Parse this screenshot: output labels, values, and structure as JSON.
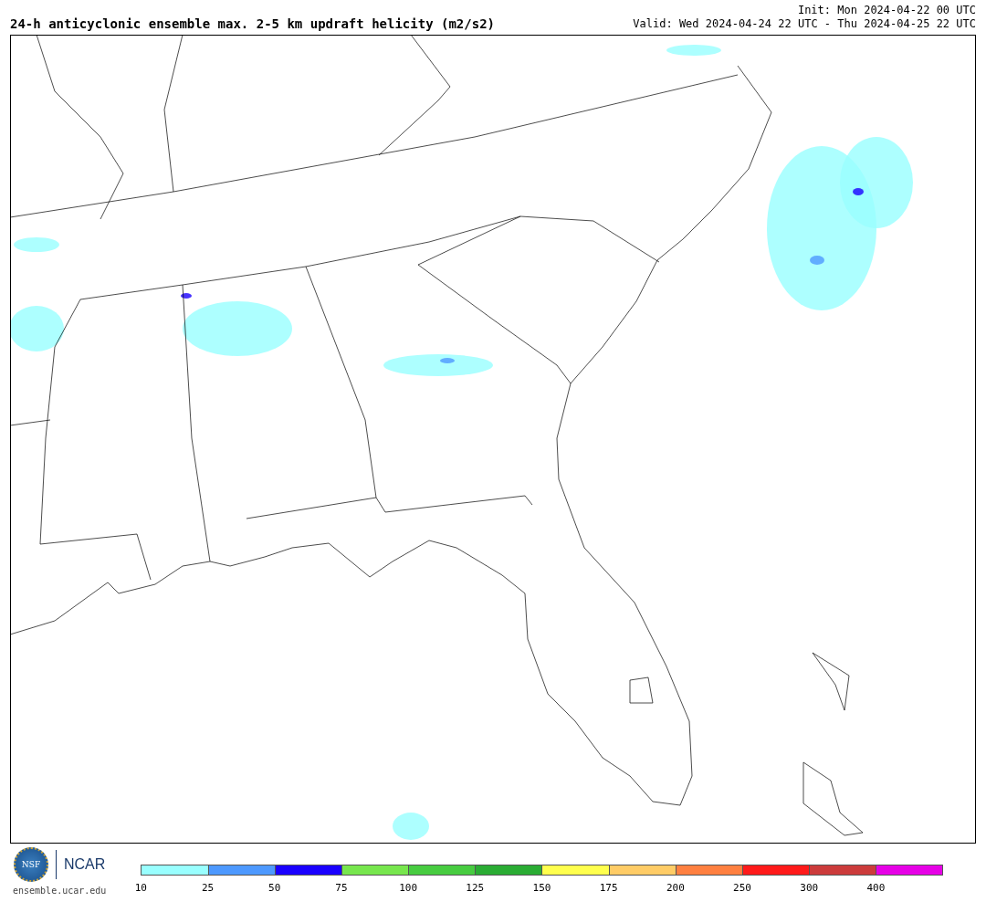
{
  "header": {
    "title": "24-h anticyclonic ensemble max. 2-5 km updraft helicity (m2/s2)",
    "init": "Init: Mon 2024-04-22 00 UTC",
    "valid": "Valid: Wed 2024-04-24 22 UTC - Thu 2024-04-25 22 UTC"
  },
  "footer": {
    "logos": [
      "NSF",
      "NCAR"
    ],
    "site": "ensemble.ucar.edu"
  },
  "colorbar": [
    {
      "label": "10",
      "color": "#99ffff"
    },
    {
      "label": "25",
      "color": "#4d99ff"
    },
    {
      "label": "50",
      "color": "#1a00ff"
    },
    {
      "label": "75",
      "color": "#77e64d"
    },
    {
      "label": "100",
      "color": "#47cc40"
    },
    {
      "label": "125",
      "color": "#2aac33"
    },
    {
      "label": "150",
      "color": "#ffff4d"
    },
    {
      "label": "175",
      "color": "#ffcc66"
    },
    {
      "label": "200",
      "color": "#ff8040"
    },
    {
      "label": "250",
      "color": "#ff1a1a"
    },
    {
      "label": "300",
      "color": "#cc3b3b"
    },
    {
      "label": "400",
      "color": "#e600e6"
    }
  ]
}
